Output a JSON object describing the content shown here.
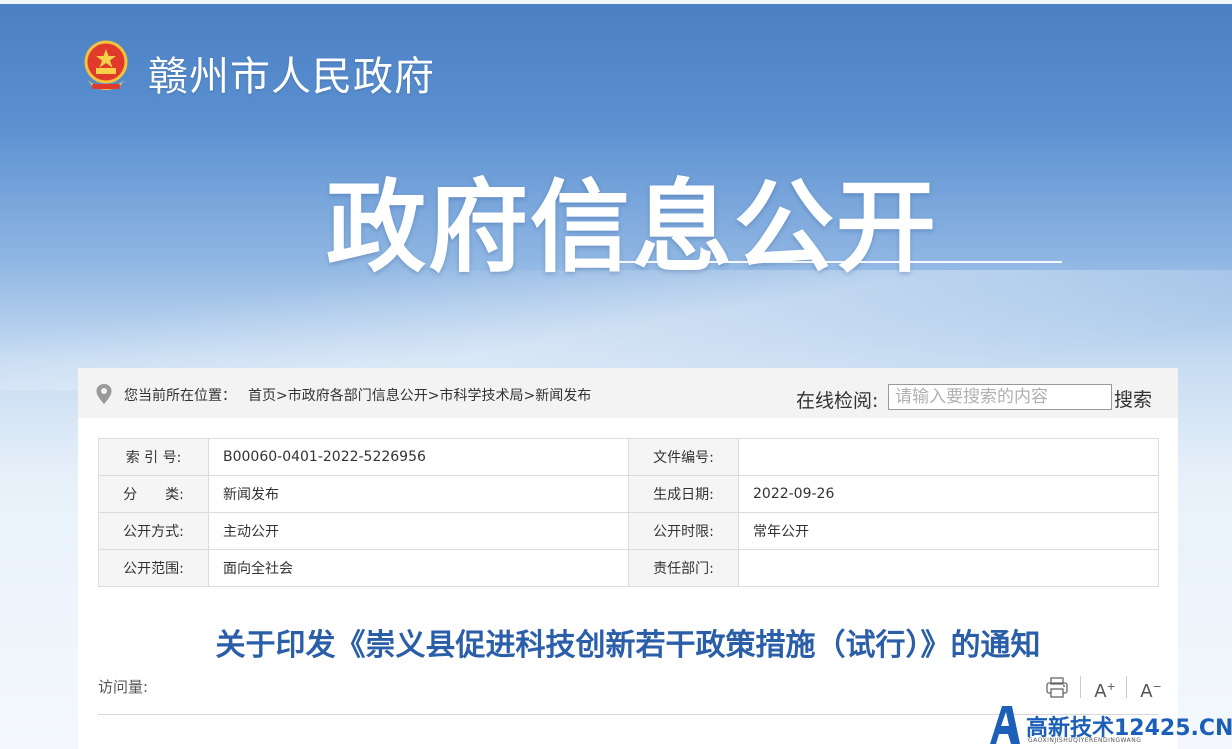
{
  "header": {
    "site_title": "赣州市人民政府",
    "banner_title": "政府信息公开"
  },
  "breadcrumb": {
    "label": "您当前所在位置：",
    "items": [
      "首页",
      "市政府各部门信息公开",
      "市科学技术局",
      "新闻发布"
    ],
    "separator": ">"
  },
  "search": {
    "label": "在线检阅:",
    "placeholder": "请输入要搜索的内容",
    "value": "",
    "button_label": "搜索"
  },
  "meta": {
    "rows": [
      {
        "k1": "索 引 号:",
        "v1": "B00060-0401-2022-5226956",
        "k2": "文件编号:",
        "v2": ""
      },
      {
        "k1": "分　　类:",
        "v1": "新闻发布",
        "k2": "生成日期:",
        "v2": "2022-09-26"
      },
      {
        "k1": "公开方式:",
        "v1": "主动公开",
        "k2": "公开时限:",
        "v2": "常年公开"
      },
      {
        "k1": "公开范围:",
        "v1": "面向全社会",
        "k2": "责任部门:",
        "v2": ""
      }
    ]
  },
  "article": {
    "title": "关于印发《崇义县促进科技创新若干政策措施（试行）》的通知",
    "visits_label": "访问量:",
    "font_increase_label": "A",
    "font_decrease_label": "A"
  },
  "watermark": {
    "title": "高新技术12425.CN",
    "subtitle": "GAOXINJISHUQIYERENDINGWANG"
  },
  "colors": {
    "title_blue": "#2a5ea8",
    "banner_blue": "#4a7fc3",
    "watermark_blue": "#1c5fb8"
  },
  "icons": {
    "logo": "national-emblem-icon",
    "location": "location-pin-icon",
    "print": "print-icon"
  }
}
